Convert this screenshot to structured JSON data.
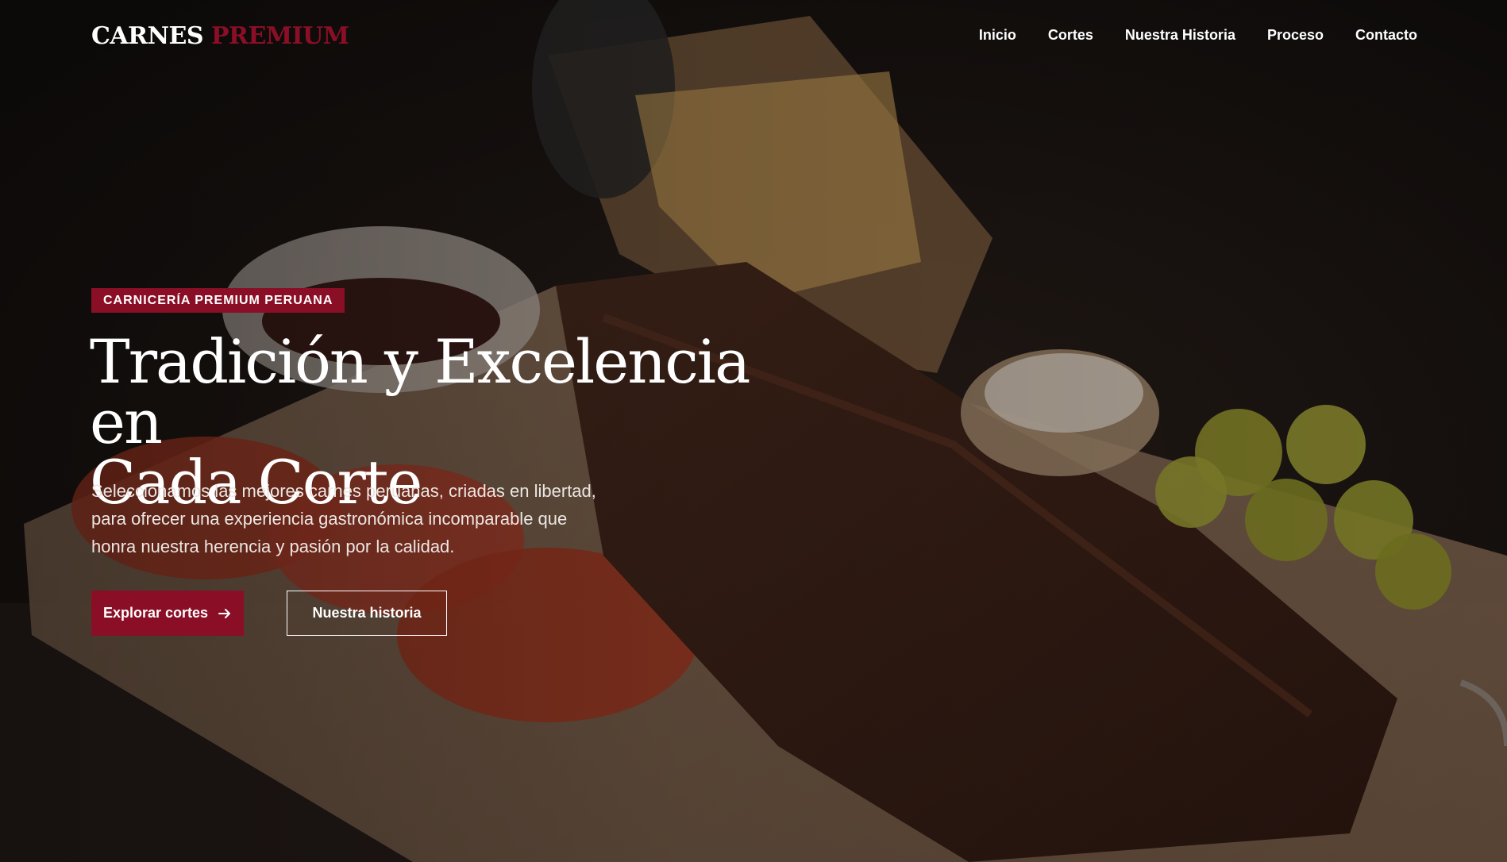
{
  "nav": {
    "logo_primary": "CARNES",
    "logo_secondary": "PREMIUM",
    "items": [
      {
        "label": "Inicio"
      },
      {
        "label": "Cortes"
      },
      {
        "label": "Nuestra Historia"
      },
      {
        "label": "Proceso"
      },
      {
        "label": "Contacto"
      }
    ]
  },
  "hero": {
    "badge": "CARNICERÍA PREMIUM PERUANA",
    "title_line1": "Tradición y Excelencia en",
    "title_line2": "Cada Corte",
    "subtitle_line1": "Seleccionamos las mejores carnes peruanas, criadas en libertad,",
    "subtitle_line2": "para ofrecer una experiencia gastronómica incomparable que",
    "subtitle_line3": "honra nuestra herencia y pasión por la calidad.",
    "primary_button": "Explorar cortes",
    "primary_button_icon": "arrow-right-icon",
    "secondary_button": "Nuestra historia"
  },
  "colors": {
    "accent": "#8a0f26",
    "background": "#120f0e",
    "text": "#ffffff"
  }
}
